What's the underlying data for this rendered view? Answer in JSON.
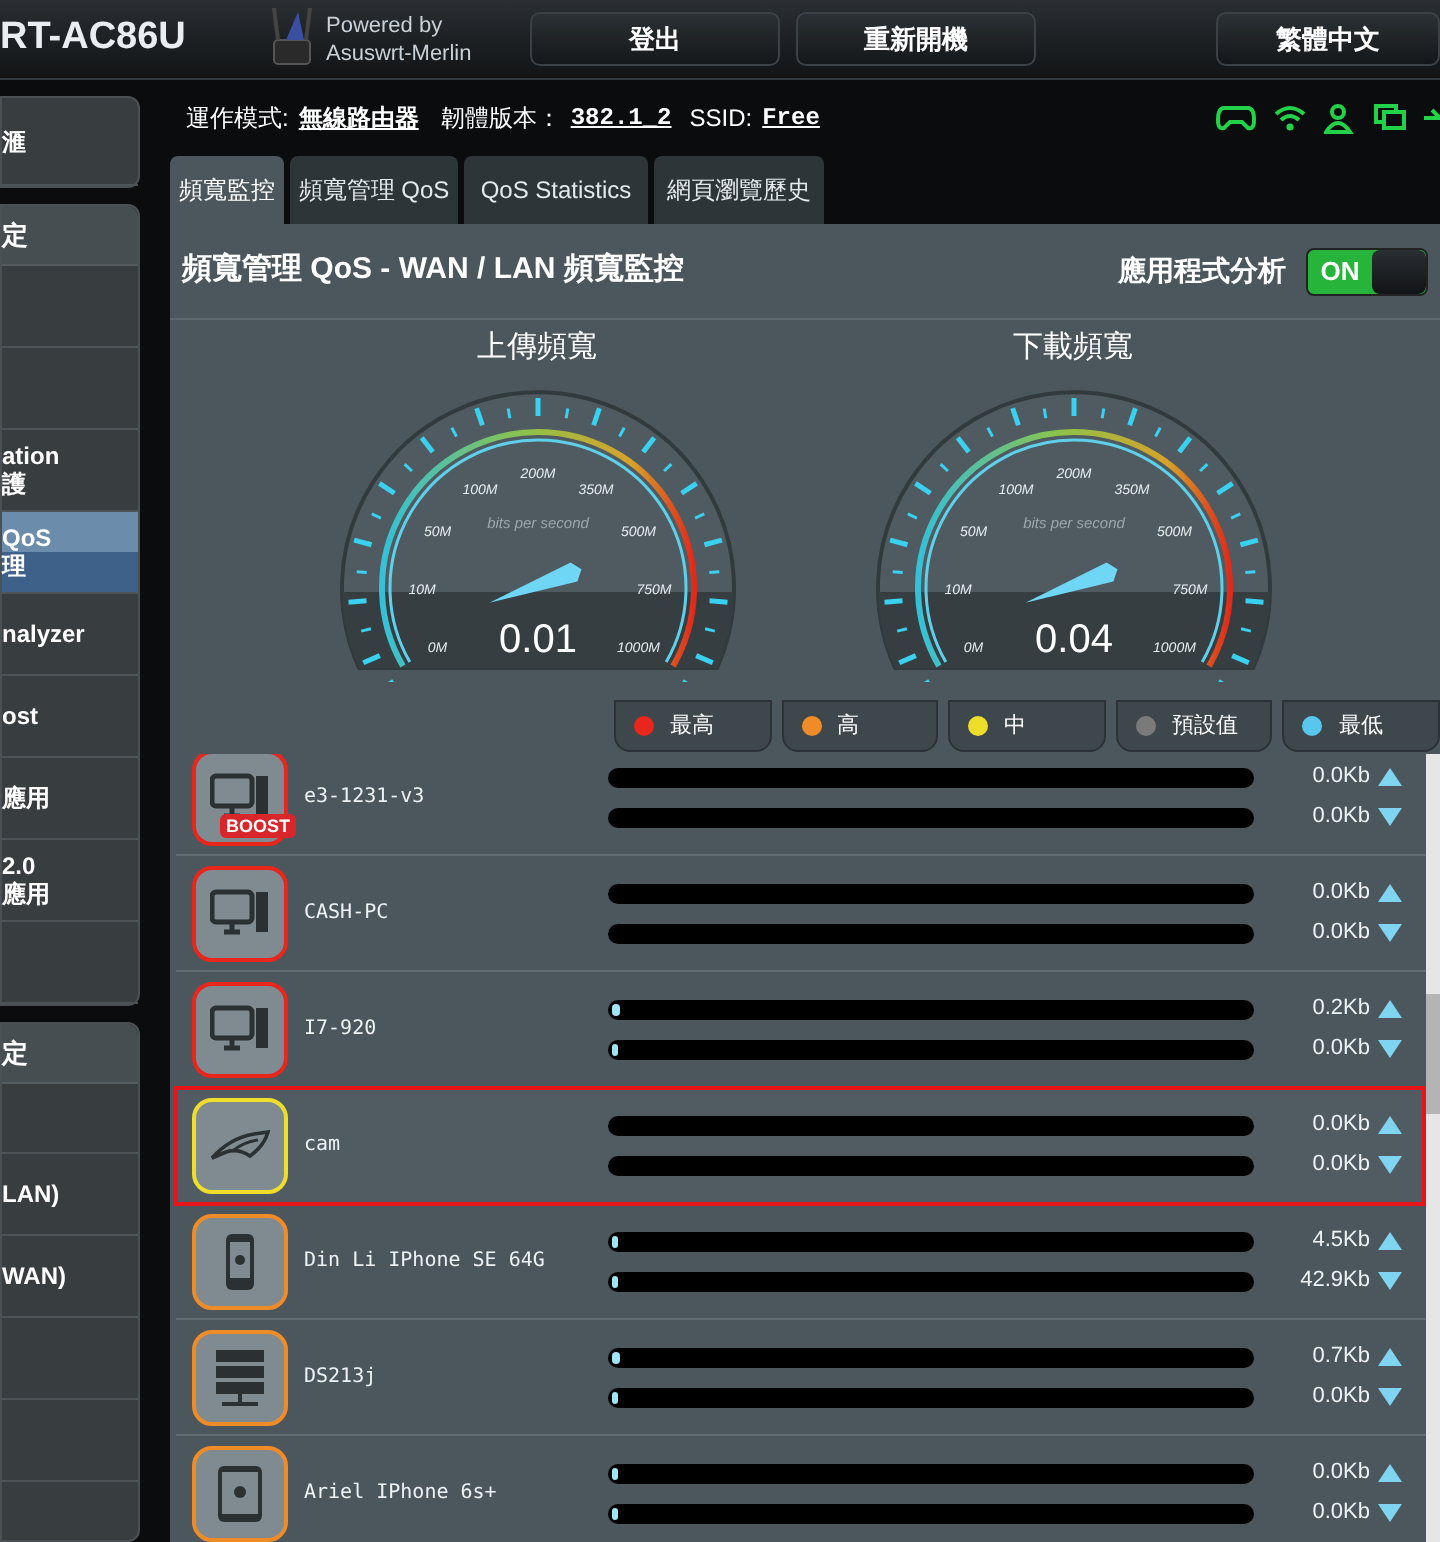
{
  "header": {
    "model": "RT-AC86U",
    "powered_by": "Powered by",
    "brand": "Asuswrt-Merlin",
    "buttons": [
      "登出",
      "重新開機",
      "繁體中文"
    ]
  },
  "sidebar": {
    "blocks": [
      {
        "items": [
          {
            "lines": [
              "滙"
            ],
            "selected": false
          }
        ]
      },
      {
        "header": "定",
        "items": [
          {
            "selected": false
          },
          {
            "selected": false
          },
          {
            "lines": [
              "ation",
              "護"
            ],
            "selected": false
          },
          {
            "lines": [
              "QoS",
              "理"
            ],
            "selected": true
          },
          {
            "lines": [
              "nalyzer"
            ],
            "selected": false
          },
          {
            "lines": [
              "ost"
            ],
            "selected": false
          },
          {
            "lines": [
              "應用"
            ],
            "selected": false
          },
          {
            "lines": [
              "2.0",
              "應用"
            ],
            "selected": false
          },
          {
            "selected": false
          }
        ]
      },
      {
        "header": "定",
        "items": [
          {
            "selected": false
          },
          {
            "lines": [
              "LAN)"
            ],
            "selected": false
          },
          {
            "lines": [
              "WAN)"
            ],
            "selected": false
          },
          {
            "selected": false
          },
          {
            "selected": false
          }
        ]
      }
    ]
  },
  "status": {
    "op_mode_label": "運作模式:",
    "op_mode": "無線路由器",
    "firmware_label": "韌體版本：",
    "firmware": "382.1_2",
    "ssid_label": "SSID:",
    "ssid": "Free"
  },
  "tabs": [
    {
      "label": "頻寬監控",
      "selected": true
    },
    {
      "label": "頻寬管理 QoS",
      "selected": false
    },
    {
      "label": "QoS Statistics",
      "selected": false
    },
    {
      "label": "網頁瀏覽歷史",
      "selected": false
    }
  ],
  "panel": {
    "title": "頻寬管理 QoS - WAN / LAN 頻寬監控",
    "app_analysis": {
      "label": "應用程式分析",
      "on": true,
      "text": "ON"
    }
  },
  "gauges": [
    {
      "title": "上傳頻寬",
      "unit": "bits per second",
      "scale": [
        "0M",
        "10M",
        "50M",
        "100M",
        "200M",
        "350M",
        "500M",
        "750M",
        "1000M"
      ],
      "reading": "0.01"
    },
    {
      "title": "下載頻寬",
      "unit": "bits per second",
      "scale": [
        "0M",
        "10M",
        "50M",
        "100M",
        "200M",
        "350M",
        "500M",
        "750M",
        "1000M"
      ],
      "reading": "0.04"
    }
  ],
  "legend": [
    {
      "label": "最高",
      "color": "#e8261c"
    },
    {
      "label": "高",
      "color": "#f08c28"
    },
    {
      "label": "中",
      "color": "#eedd2a"
    },
    {
      "label": "預設值",
      "color": "#7a7a7a"
    },
    {
      "label": "最低",
      "color": "#58c7ee"
    }
  ],
  "devices": [
    {
      "name": "e3-1231-v3",
      "kind": "pc",
      "color": "#e8261c",
      "badge": "BOOST",
      "selected": false,
      "up": {
        "reading": "0.0Kb"
      },
      "down": {
        "reading": "0.0Kb"
      }
    },
    {
      "name": "CASH-PC",
      "kind": "pc",
      "color": "#e8261c",
      "selected": false,
      "up": {
        "reading": "0.0Kb"
      },
      "down": {
        "reading": "0.0Kb"
      }
    },
    {
      "name": "I7-920",
      "kind": "pc",
      "color": "#e8261c",
      "selected": false,
      "up": {
        "level": 0.012,
        "reading": "0.2Kb"
      },
      "down": {
        "level": 0.006,
        "reading": "0.0Kb"
      }
    },
    {
      "name": "cam",
      "kind": "rog",
      "color": "#eedd2a",
      "selected": true,
      "up": {
        "reading": "0.0Kb"
      },
      "down": {
        "reading": "0.0Kb"
      }
    },
    {
      "name": "Din Li IPhone SE 64G",
      "kind": "phone",
      "color": "#f08c28",
      "selected": false,
      "up": {
        "level": 0.006,
        "reading": "4.5Kb"
      },
      "down": {
        "level": 0.006,
        "reading": "42.9Kb"
      }
    },
    {
      "name": "DS213j",
      "kind": "nas",
      "color": "#f08c28",
      "selected": false,
      "up": {
        "level": 0.012,
        "reading": "0.7Kb"
      },
      "down": {
        "level": 0.006,
        "reading": "0.0Kb"
      }
    },
    {
      "name": "Ariel IPhone 6s+",
      "kind": "tablet",
      "color": "#f08c28",
      "selected": false,
      "up": {
        "level": 0.006,
        "reading": "0.0Kb"
      },
      "down": {
        "level": 0.006,
        "reading": "0.0Kb"
      }
    }
  ]
}
